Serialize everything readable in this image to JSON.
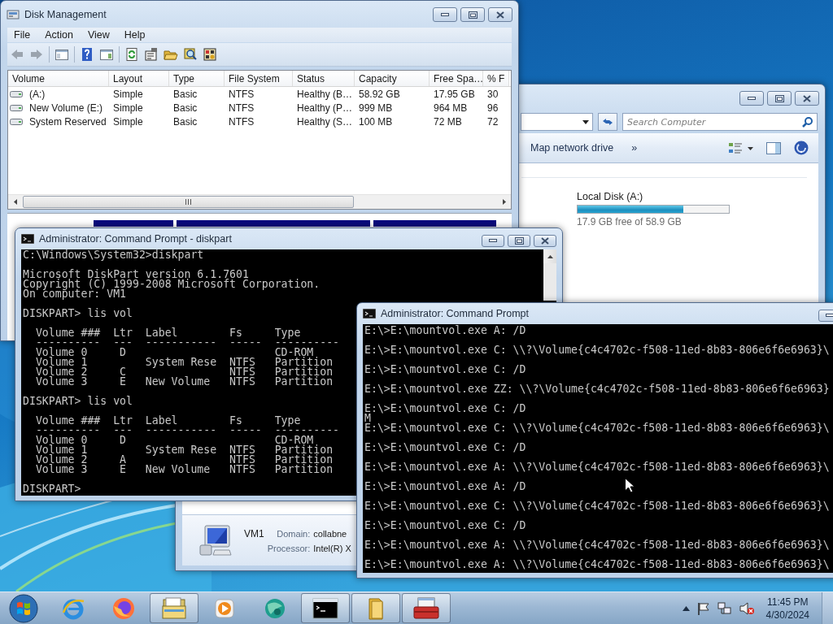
{
  "explorer": {
    "search": {
      "placeholder": "Search Computer"
    },
    "toolbar": [
      "Map network drive",
      "»"
    ],
    "drive": {
      "name": "Local Disk (A:)",
      "level": 0.7,
      "free": "17.9 GB free of 58.9 GB"
    },
    "details": {
      "name": "VM1",
      "fields": [
        {
          "label": "Domain:",
          "value": "collabne"
        },
        {
          "label": "Processor:",
          "value": "Intel(R) X"
        }
      ]
    }
  },
  "disk_management": {
    "title": "Disk Management",
    "menu": [
      "File",
      "Action",
      "View",
      "Help"
    ],
    "columns": [
      "Volume",
      "Layout",
      "Type",
      "File System",
      "Status",
      "Capacity",
      "Free Spa…",
      "% F"
    ],
    "rows": [
      {
        "volume": "(A:)",
        "layout": "Simple",
        "type": "Basic",
        "file_system": "NTFS",
        "status": "Healthy (B…",
        "capacity": "58.92 GB",
        "free_space": "17.95 GB",
        "column_8": "30"
      },
      {
        "volume": "New Volume (E:)",
        "layout": "Simple",
        "type": "Basic",
        "file_system": "NTFS",
        "status": "Healthy (P…",
        "capacity": "999 MB",
        "free_space": "964 MB",
        "column_8": "96"
      },
      {
        "volume": "System Reserved",
        "layout": "Simple",
        "type": "Basic",
        "file_system": "NTFS",
        "status": "Healthy (S…",
        "capacity": "100 MB",
        "free_space": "72 MB",
        "column_8": "72"
      }
    ]
  },
  "cmd_diskpart": {
    "title": "Administrator:  Command Prompt - diskpart",
    "blocks": [
      [
        "C:\\Windows\\System32>diskpart"
      ],
      [
        "Microsoft DiskPart version 6.1.7601",
        "Copyright (C) 1999-2008 Microsoft Corporation.",
        "On computer: VM1"
      ],
      [
        "DISKPART> lis vol"
      ],
      [
        "  Volume ###  Ltr  Label        Fs     Type",
        "  ----------  ---  -----------  -----  ----------",
        "  Volume 0     D                       CD-ROM",
        "  Volume 1         System Rese  NTFS   Partition",
        "  Volume 2     C                NTFS   Partition",
        "  Volume 3     E   New Volume   NTFS   Partition"
      ],
      [
        "DISKPART> lis vol"
      ],
      [
        "  Volume ###  Ltr  Label        Fs     Type",
        "  ----------  ---  -----------  -----  ----------",
        "  Volume 0     D                       CD-ROM",
        "  Volume 1         System Rese  NTFS   Partition",
        "  Volume 2     A                NTFS   Partition",
        "  Volume 3     E   New Volume   NTFS   Partition"
      ],
      [
        "DISKPART>"
      ]
    ]
  },
  "cmd_mountvol": {
    "title": "Administrator:  Command Prompt",
    "blocks": [
      [
        "E:\\>E:\\mountvol.exe A: /D"
      ],
      [
        "E:\\>E:\\mountvol.exe C: \\\\?\\Volume{c4c4702c-f508-11ed-8b83-806e6f6e6963}\\"
      ],
      [
        "E:\\>E:\\mountvol.exe C: /D"
      ],
      [
        "E:\\>E:\\mountvol.exe ZZ: \\\\?\\Volume{c4c4702c-f508-11ed-8b83-806e6f6e6963}"
      ],
      [
        "E:\\>E:\\mountvol.exe C: /D",
        "M",
        "E:\\>E:\\mountvol.exe C: \\\\?\\Volume{c4c4702c-f508-11ed-8b83-806e6f6e6963}\\"
      ],
      [
        "E:\\>E:\\mountvol.exe C: /D"
      ],
      [
        "E:\\>E:\\mountvol.exe A: \\\\?\\Volume{c4c4702c-f508-11ed-8b83-806e6f6e6963}\\"
      ],
      [
        "E:\\>E:\\mountvol.exe A: /D"
      ],
      [
        "E:\\>E:\\mountvol.exe C: \\\\?\\Volume{c4c4702c-f508-11ed-8b83-806e6f6e6963}\\"
      ],
      [
        "E:\\>E:\\mountvol.exe C: /D"
      ],
      [
        "E:\\>E:\\mountvol.exe A: \\\\?\\Volume{c4c4702c-f508-11ed-8b83-806e6f6e6963}\\"
      ],
      [
        "E:\\>E:\\mountvol.exe A: \\\\?\\Volume{c4c4702c-f508-11ed-8b83-806e6f6e6963}\\"
      ]
    ]
  },
  "taskbar": {
    "apps": [
      {
        "kind": "ie",
        "running": false
      },
      {
        "kind": "firefox",
        "running": false
      },
      {
        "kind": "explorer",
        "running": true
      },
      {
        "kind": "media",
        "running": false
      },
      {
        "kind": "globe",
        "running": false
      },
      {
        "kind": "cmd",
        "running": true
      },
      {
        "kind": "folder",
        "running": true
      },
      {
        "kind": "toolbox",
        "running": true
      }
    ],
    "volume_muted": true,
    "clock": {
      "time": "11:45 PM",
      "date": "4/30/2024"
    }
  }
}
